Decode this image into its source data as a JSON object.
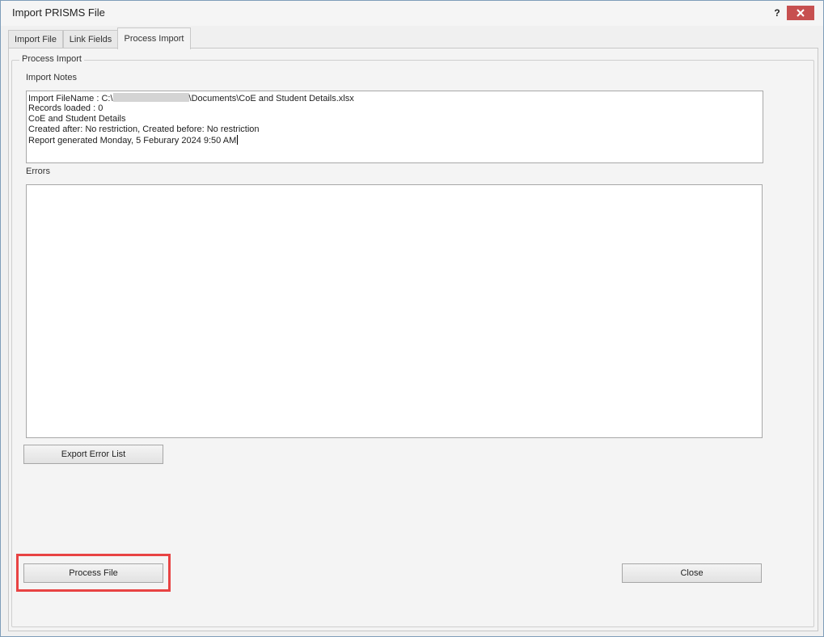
{
  "window": {
    "title": "Import PRISMS File",
    "help_label": "?"
  },
  "tabs": [
    {
      "label": "Import File"
    },
    {
      "label": "Link Fields"
    },
    {
      "label": "Process Import"
    }
  ],
  "process_import": {
    "group_label": "Process Import",
    "notes_label": "Import Notes",
    "notes": {
      "filename_prefix": "Import FileName : C:\\",
      "filename_suffix": "\\Documents\\CoE and Student Details.xlsx",
      "records_loaded": "Records loaded : 0",
      "report_name": "CoE and Student Details",
      "restrictions": "Created after: No restriction, Created before: No restriction",
      "generated": "Report generated Monday, 5 Feburary 2024 9:50 AM"
    },
    "errors_label": "Errors",
    "export_button": "Export Error List",
    "process_button": "Process File",
    "close_button": "Close"
  },
  "colors": {
    "highlight": "#e84343",
    "close_button_bg": "#c75050"
  }
}
